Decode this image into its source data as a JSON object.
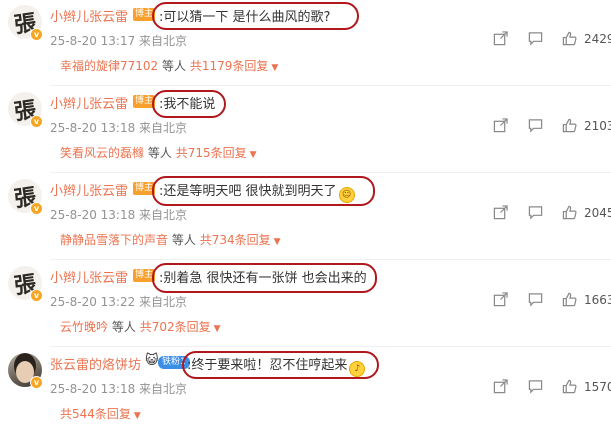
{
  "comments": [
    {
      "author": "小辫儿张云雷",
      "role_badge": "博主",
      "avatar_glyph": "張",
      "verified": "v",
      "text": ":可以猜一下 是什么曲风的歌?",
      "emoji": "",
      "meta": "25-8-20 13:17 来自北京",
      "likes": "2429",
      "reply_user": "幸福的旋律77102",
      "reply_join": "等人",
      "reply_count": "共1179条回复"
    },
    {
      "author": "小辫儿张云雷",
      "role_badge": "博主",
      "avatar_glyph": "張",
      "verified": "v",
      "text": ":我不能说",
      "emoji": "",
      "meta": "25-8-20 13:18 来自北京",
      "likes": "2103",
      "reply_user": "笑看风云的磊橼",
      "reply_join": "等人",
      "reply_count": "共715条回复"
    },
    {
      "author": "小辫儿张云雷",
      "role_badge": "博主",
      "avatar_glyph": "張",
      "verified": "v",
      "text": ":还是等明天吧 很快就到明天了",
      "emoji": "grin-emoji",
      "meta": "25-8-20 13:18 来自北京",
      "likes": "2045",
      "reply_user": "静静品雪落下的声音",
      "reply_join": "等人",
      "reply_count": "共734条回复"
    },
    {
      "author": "小辫儿张云雷",
      "role_badge": "博主",
      "avatar_glyph": "張",
      "verified": "v",
      "text": ":别着急 很快还有一张饼 也会出来的",
      "emoji": "",
      "meta": "25-8-20 13:22 来自北京",
      "likes": "1663",
      "reply_user": "云竹晚吟",
      "reply_join": "等人",
      "reply_count": "共702条回复"
    },
    {
      "author": "张云雷的烙饼坊",
      "role_badge": "铁粉1",
      "avatar_glyph": "",
      "verified": "v",
      "text": ":终于要来啦！忍不住哼起来",
      "emoji": "sing-emoji",
      "meta": "25-8-20 13:18 来自北京",
      "likes": "1570",
      "reply_user": "",
      "reply_join": "",
      "reply_count": "共544条回复"
    }
  ],
  "icons": [
    "share-icon",
    "comment-icon",
    "like-icon",
    "caret-down-icon"
  ],
  "colors": {
    "name": "#eb7350",
    "meta": "#939393",
    "highlight_oval": "#b0181e",
    "blogger_badge": "#f7a02e"
  }
}
